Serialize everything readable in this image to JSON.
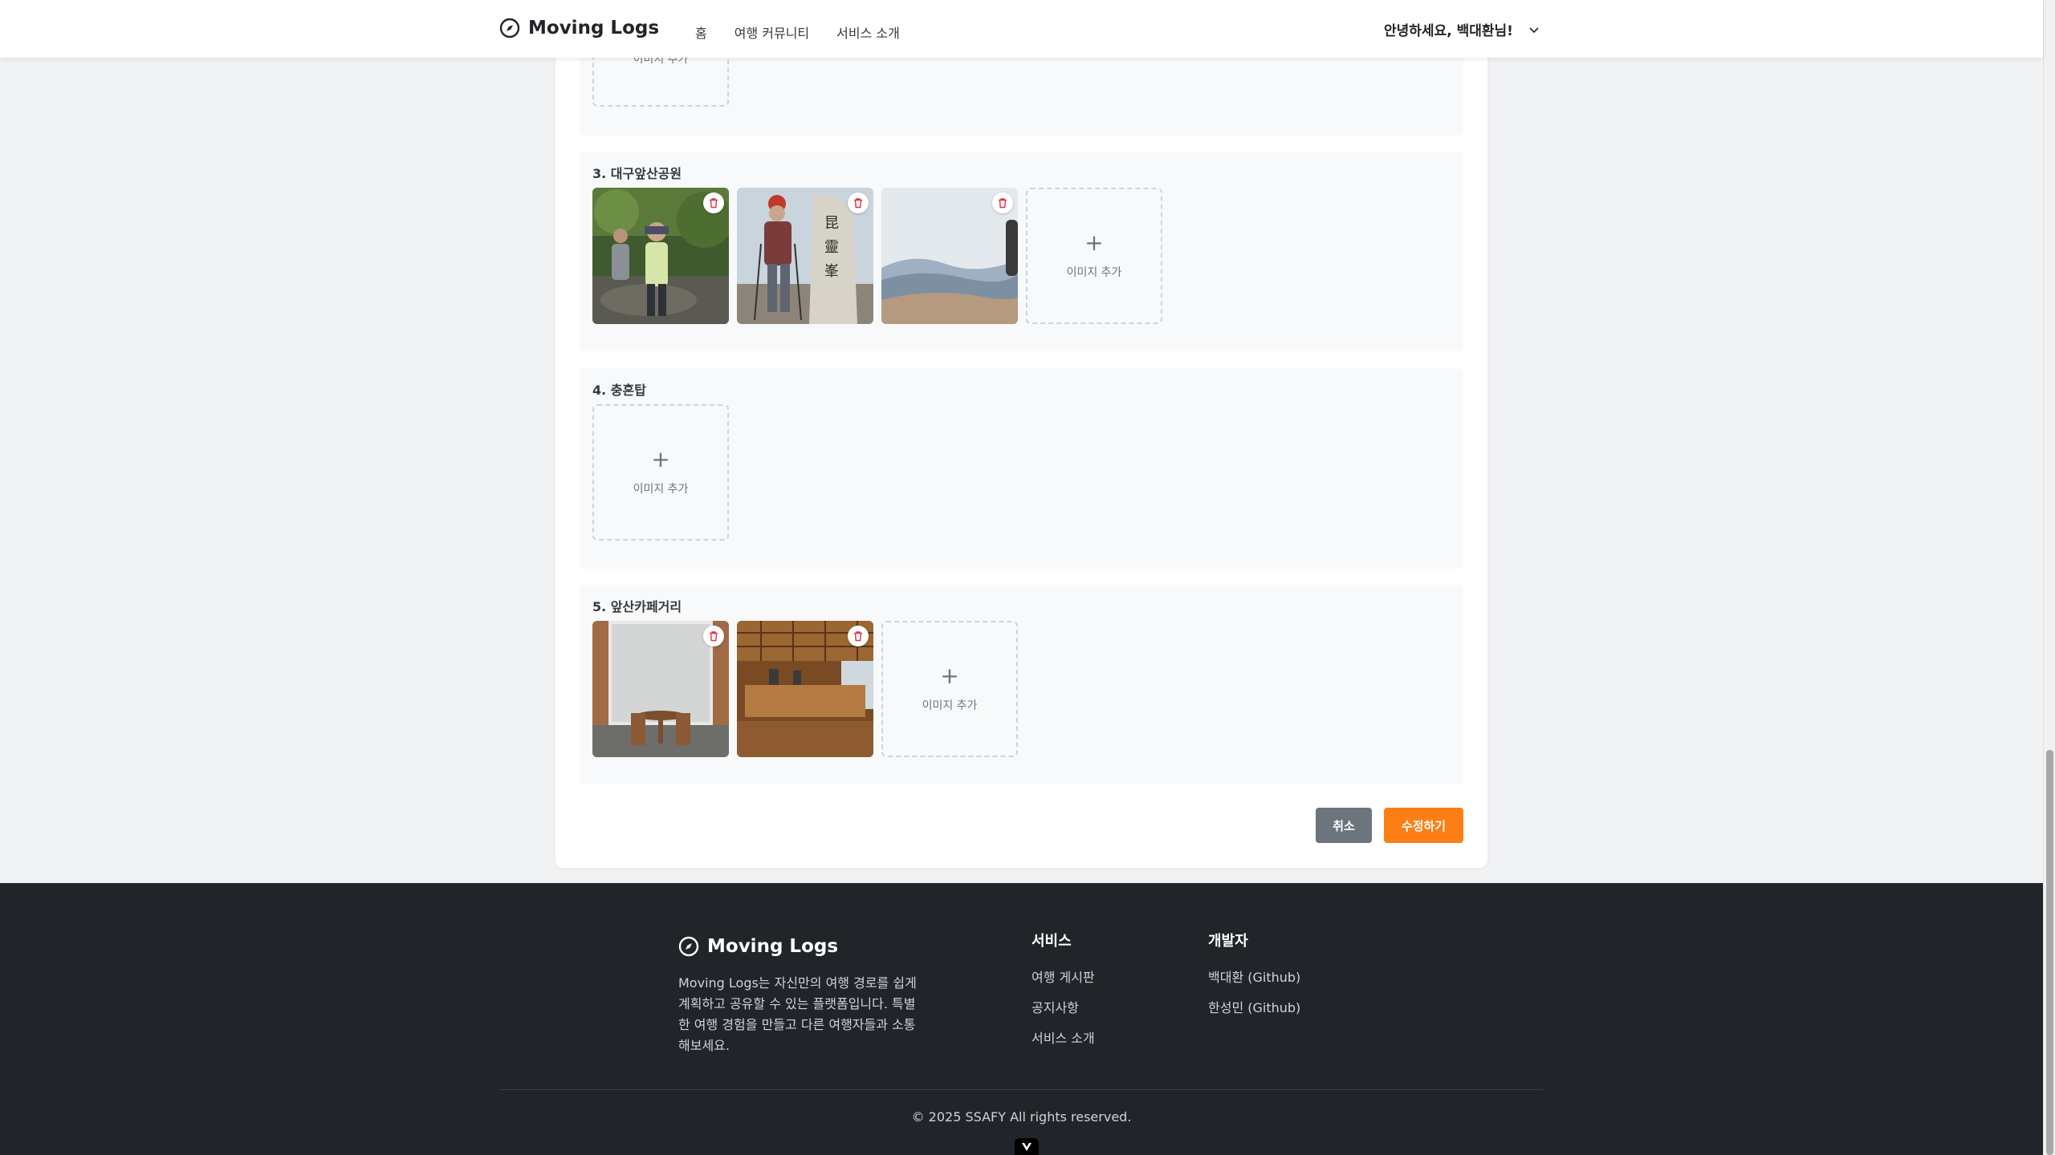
{
  "header": {
    "logo_text": "Moving Logs",
    "logo_icon": "compass-icon",
    "nav": [
      "홈",
      "여행 커뮤니티",
      "서비스 소개"
    ],
    "greeting": "안녕하세요, 백대환님!"
  },
  "sections": [
    {
      "title": "",
      "add_label": "이미지 추가"
    },
    {
      "title": "3. 대구앞산공원",
      "images": [
        "hikers-on-trail",
        "hiker-at-summit-stone",
        "mountain-view"
      ],
      "add_label": "이미지 추가"
    },
    {
      "title": "4. 충혼탑",
      "images": [],
      "add_label": "이미지 추가"
    },
    {
      "title": "5. 앞산카페거리",
      "images": [
        "cafe-window-seating",
        "cafe-interior"
      ],
      "add_label": "이미지 추가"
    }
  ],
  "actions": {
    "cancel": "취소",
    "submit": "수정하기"
  },
  "footer": {
    "logo_text": "Moving Logs",
    "description": "Moving Logs는 자신만의 여행 경로를 쉽게 계획하고 공유할 수 있는 플랫폼입니다. 특별한 여행 경험을 만들고 다른 여행자들과 소통해보세요.",
    "service_title": "서비스",
    "service_links": [
      "여행 게시판",
      "공지사항",
      "서비스 소개"
    ],
    "dev_title": "개발자",
    "dev_links": [
      "백대환 (Github)",
      "한성민 (Github)"
    ],
    "copyright": "© 2025 SSAFY All rights reserved."
  },
  "colors": {
    "accent": "#fd7e14",
    "cancel": "#6c757d",
    "footer_bg": "#212529",
    "delete_icon": "#dc3545"
  }
}
